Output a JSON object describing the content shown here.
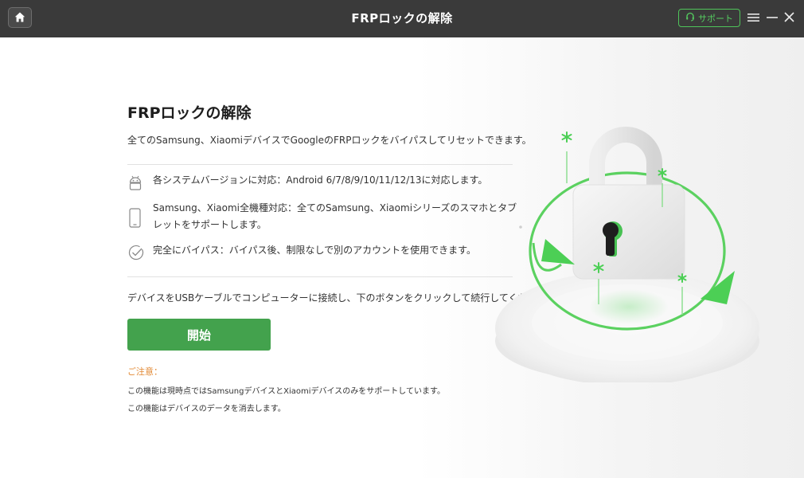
{
  "window": {
    "title": "FRPロックの解除",
    "support_label": "サポート"
  },
  "main": {
    "heading": "FRPロックの解除",
    "subtitle": "全てのSamsung、XiaomiデバイスでGoogleのFRPロックをバイパスしてリセットできます。",
    "features": [
      {
        "icon": "android-icon",
        "text": "各システムバージョンに対応：Android 6/7/8/9/10/11/12/13に対応します。"
      },
      {
        "icon": "phone-icon",
        "text": "Samsung、Xiaomi全機種対応：全てのSamsung、Xiaomiシリーズのスマホとタブレットをサポートします。"
      },
      {
        "icon": "check-circle-icon",
        "text": "完全にバイパス：バイパス後、制限なしで別のアカウントを使用できます。"
      }
    ],
    "instruction": "デバイスをUSBケーブルでコンピューターに接続し、下のボタンをクリックして続行してください。",
    "start_label": "開始",
    "notes": {
      "title": "ご注意：",
      "lines": [
        "この機能は現時点ではSamsungデバイスとXiaomiデバイスのみをサポートしています。",
        "この機能はデバイスのデータを消去します。"
      ]
    }
  },
  "colors": {
    "titlebar": "#3a3a3a",
    "accent_green": "#43a24d",
    "support_green": "#55cc60",
    "note_orange": "#e28a36"
  }
}
